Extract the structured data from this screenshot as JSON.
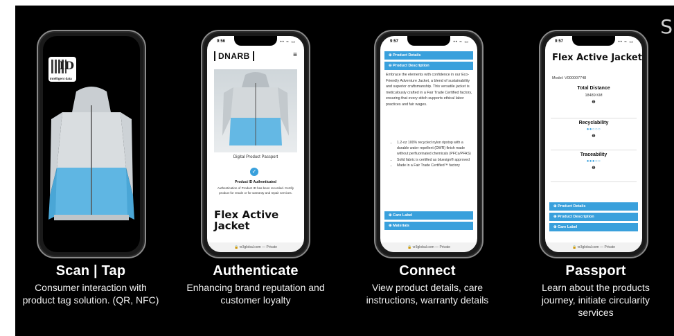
{
  "corner_glyph": "S",
  "phones": {
    "scan": {
      "tag": {
        "id_text": "ID",
        "label": "Intelligent data"
      }
    },
    "authenticate": {
      "time": "9:56",
      "signal": "•• ≈ ▭",
      "logo": "DNARB",
      "menu": "≡",
      "dpp": "Digital Product Passport",
      "auth_heading": "Product ID Authenticated",
      "auth_text": "Authentication of Product ID has been recorded. Certify product for resale or for warranty and repair services.",
      "title": "Flex Active Jacket",
      "url": "🔒 vr3global.com — Private"
    },
    "connect": {
      "time": "9:57",
      "signal": "•• ≈ ▭",
      "bar_details": "⊕ Product Details",
      "bar_description": "⊖ Product Description",
      "description": "Embrace the elements with confidence in our Eco-Friendly Adventure Jacket, a blend of sustainability and superior craftsmanship. This versatile jacket is meticulously crafted in a Fair Trade Certified factory, ensuring that every stitch supports ethical labor practices and fair wages.",
      "bullets": [
        "1.2-oz 100% recycled nylon ripstop with a durable water repellent (DWR) finish made without perfluorinated chemicals (PFCs/PFAS)",
        "Solid fabric is certified as bluesign® approved",
        "Made in a Fair Trade Certified™ factory"
      ],
      "bar_care": "⊕ Care Label",
      "bar_materials": "⊕ Materials",
      "url": "🔒 vr3global.com — Private"
    },
    "passport": {
      "time": "9:57",
      "signal": "•• ≈ ▭",
      "title": "Flex Active Jacket",
      "model": "Model: V000007748",
      "metrics": [
        {
          "label": "Total Distance",
          "value": "18489 KM",
          "info": "❶"
        },
        {
          "label": "Recyclability",
          "value": "●●○○○",
          "info": "❶"
        },
        {
          "label": "Traceability",
          "value": "●●●○○",
          "info": "❶"
        }
      ],
      "bar_details": "⊕ Product Details",
      "bar_description": "⊕ Product Description",
      "bar_care": "⊕ Care Label",
      "url": "🔒 vr3global.com — Private"
    }
  },
  "captions": [
    {
      "title": "Scan | Tap",
      "text": "Consumer interaction with product tag solution. (QR, NFC)"
    },
    {
      "title": "Authenticate",
      "text": "Enhancing brand reputation and customer loyalty"
    },
    {
      "title": "Connect",
      "text": "View product details, care instructions, warranty details"
    },
    {
      "title": "Passport",
      "text": "Learn about the products journey, initiate circularity services"
    }
  ],
  "colors": {
    "accent": "#39a0dc",
    "background": "#000000"
  }
}
